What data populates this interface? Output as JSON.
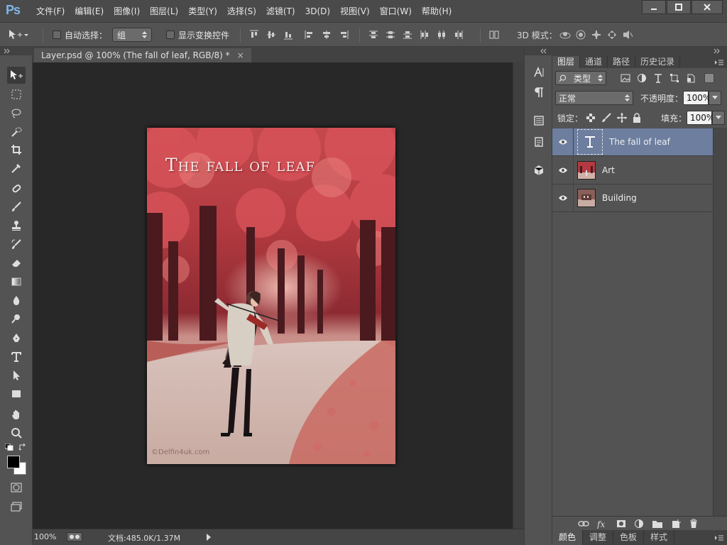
{
  "app": {
    "logo": "Ps"
  },
  "menu": [
    "文件(F)",
    "编辑(E)",
    "图像(I)",
    "图层(L)",
    "类型(Y)",
    "选择(S)",
    "滤镜(T)",
    "3D(D)",
    "视图(V)",
    "窗口(W)",
    "帮助(H)"
  ],
  "options": {
    "auto_select_label": "自动选择：",
    "auto_select_value": "组",
    "show_transform_label": "显示变换控件",
    "mode3d_label": "3D 模式："
  },
  "document": {
    "tab_title": "Layer.psd @ 100% (The fall of leaf, RGB/8) *",
    "tab_close": "×",
    "zoom": "100%",
    "doc_size": "文档:485.0K/1.37M",
    "art_title": "The fall of leaf",
    "watermark": "©Delfin4uk.com"
  },
  "panel": {
    "tabs": [
      "图层",
      "通道",
      "路径",
      "历史记录"
    ],
    "filter_kind": "类型",
    "blend_mode": "正常",
    "opacity_label": "不透明度：",
    "opacity_value": "100%",
    "lock_label": "锁定：",
    "fill_label": "填充：",
    "fill_value": "100%",
    "layers": [
      {
        "name": "The fall of leaf",
        "type": "text",
        "selected": true
      },
      {
        "name": "Art",
        "type": "image",
        "selected": false
      },
      {
        "name": "Building",
        "type": "image",
        "selected": false
      }
    ],
    "bottom_tabs": [
      "颜色",
      "调整",
      "色板",
      "样式"
    ]
  },
  "colors": {
    "accent_selected": "#6d7e9f",
    "foreground": "#000000",
    "background": "#ffffff"
  }
}
